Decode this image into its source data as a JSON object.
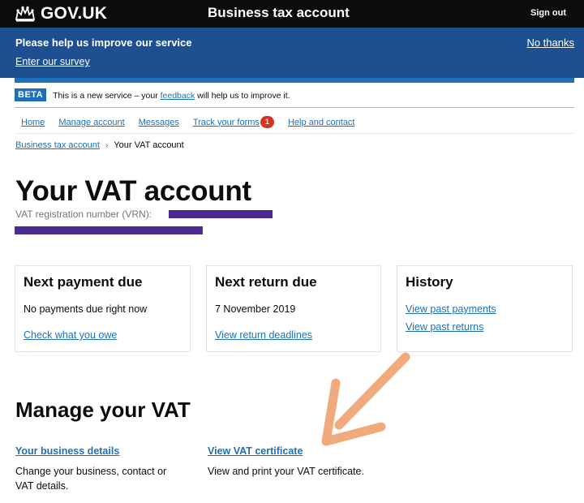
{
  "header": {
    "logo_text": "GOV.UK",
    "service_name": "Business tax account",
    "sign_out": "Sign out",
    "logo_icon": "crown-icon"
  },
  "survey": {
    "title": "Please help us improve our service",
    "link": "Enter our survey",
    "dismiss": "No thanks"
  },
  "phase": {
    "tag": "BETA",
    "text_before": "This is a new service – your ",
    "link": "feedback",
    "text_after": " will help us to improve it."
  },
  "nav": {
    "items": [
      "Home",
      "Manage account",
      "Messages",
      "Track your forms",
      "Help and contact"
    ],
    "badge": "1"
  },
  "breadcrumb": {
    "parent": "Business tax account",
    "current": "Your VAT account"
  },
  "page": {
    "title": "Your VAT account",
    "vrn_label": "VAT registration number (VRN):"
  },
  "cards": [
    {
      "title": "Next payment due",
      "text": "No payments due right now",
      "links": [
        "Check what you owe"
      ]
    },
    {
      "title": "Next return due",
      "text": "7 November 2019",
      "links": [
        "View return deadlines"
      ]
    },
    {
      "title": "History",
      "text": "",
      "links": [
        "View past payments",
        "View past returns"
      ]
    }
  ],
  "manage": {
    "title": "Manage your VAT",
    "items": [
      {
        "link": "Your business details",
        "text_line1": "Change your business, contact or",
        "text_line2": "VAT details."
      },
      {
        "link": "View VAT certificate",
        "text_line1": "View and print your VAT certificate.",
        "text_line2": ""
      }
    ]
  },
  "colors": {
    "header_bg": "#0b0c0c",
    "survey_bg": "#1d4f91",
    "link": "#1d70b8",
    "badge": "#d4351c",
    "redaction": "#4c2c92",
    "annotation_arrow": "#f0a070"
  }
}
